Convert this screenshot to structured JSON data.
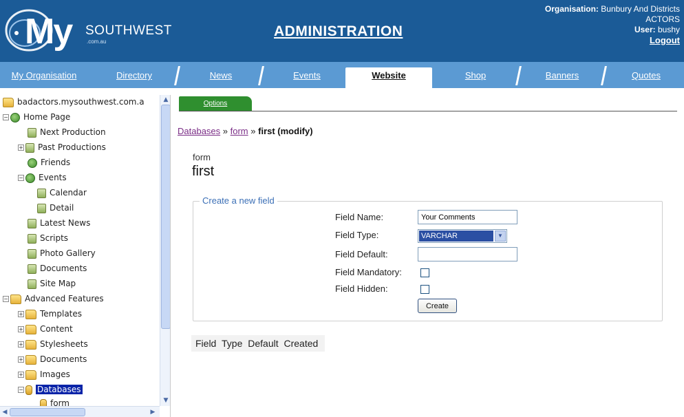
{
  "header": {
    "logo_text_my": "My",
    "logo_text_southwest": "SOUTHWEST",
    "logo_text_domain": ".com.au",
    "title": "ADMINISTRATION",
    "org_label": "Organisation:",
    "org_name_line1": "Bunbury And Districts",
    "org_name_line2": "ACTORS",
    "user_label": "User:",
    "user_name": "bushy",
    "logout_label": "Logout"
  },
  "nav": {
    "tabs": [
      {
        "label": "My Organisation"
      },
      {
        "label": "Directory"
      },
      {
        "label": "News"
      },
      {
        "label": "Events"
      },
      {
        "label": "Website",
        "active": true
      },
      {
        "label": "Shop"
      },
      {
        "label": "Banners"
      },
      {
        "label": "Quotes"
      }
    ],
    "colors": {
      "header": "#1b5b97",
      "bar": "#5b9ad3"
    }
  },
  "sidebar": {
    "root": "badactors.mysouthwest.com.a",
    "items": [
      {
        "label": "Home Page",
        "icon": "globe-icon"
      },
      {
        "label": "Next Production",
        "icon": "page-icon"
      },
      {
        "label": "Past Productions",
        "icon": "page-icon"
      },
      {
        "label": "Friends",
        "icon": "globe-icon"
      },
      {
        "label": "Events",
        "icon": "globe-icon"
      },
      {
        "label": "Calendar",
        "icon": "page-icon"
      },
      {
        "label": "Detail",
        "icon": "page-icon"
      },
      {
        "label": "Latest News",
        "icon": "page-icon"
      },
      {
        "label": "Scripts",
        "icon": "page-icon"
      },
      {
        "label": "Photo Gallery",
        "icon": "page-icon"
      },
      {
        "label": "Documents",
        "icon": "page-icon"
      },
      {
        "label": "Site Map",
        "icon": "page-icon"
      },
      {
        "label": "Advanced Features",
        "icon": "folder-icon"
      },
      {
        "label": "Templates",
        "icon": "folder-icon"
      },
      {
        "label": "Content",
        "icon": "folder-icon"
      },
      {
        "label": "Stylesheets",
        "icon": "folder-icon"
      },
      {
        "label": "Documents",
        "icon": "folder-icon"
      },
      {
        "label": "Images",
        "icon": "folder-icon"
      },
      {
        "label": "Databases",
        "icon": "database-icon",
        "selected": true
      },
      {
        "label": "form",
        "icon": "database-icon"
      }
    ]
  },
  "main": {
    "options_tab": "Options",
    "breadcrumb": {
      "link1": "Databases",
      "sep": "»",
      "link2": "form",
      "current": "first (modify)"
    },
    "record_sub": "form",
    "record_title": "first",
    "fieldset_legend": "Create a new field",
    "form": {
      "field_name_label": "Field Name:",
      "field_name_value": "Your Comments",
      "field_type_label": "Field Type:",
      "field_type_value": "VARCHAR",
      "field_default_label": "Field Default:",
      "field_default_value": "",
      "field_mandatory_label": "Field Mandatory:",
      "field_hidden_label": "Field Hidden:",
      "create_label": "Create"
    },
    "table_headers": [
      "Field",
      "Type",
      "Default",
      "Created"
    ]
  }
}
